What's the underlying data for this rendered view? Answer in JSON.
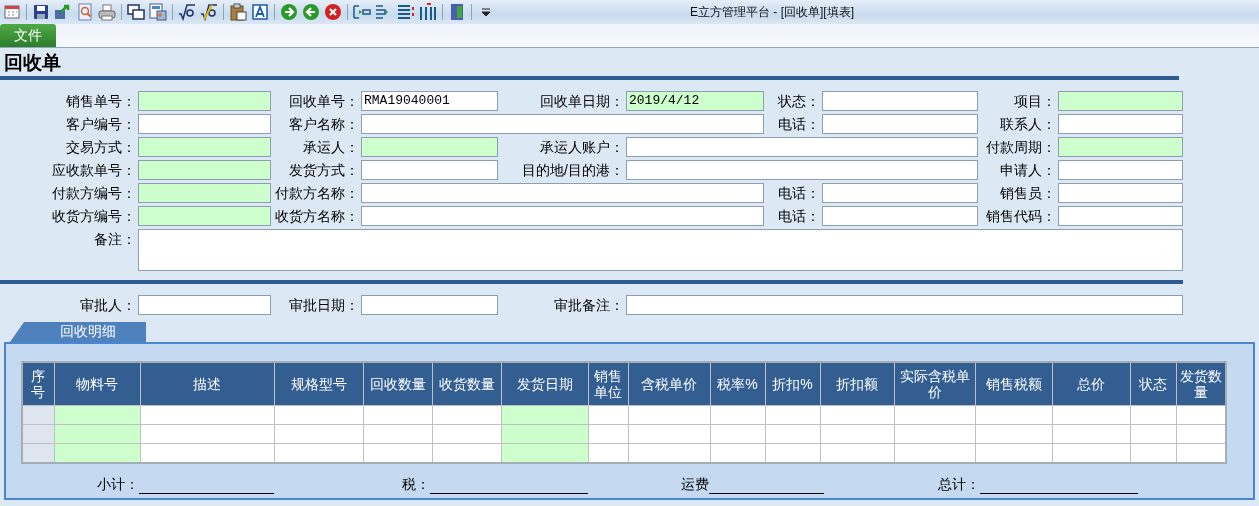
{
  "window": {
    "title": "E立方管理平台  -  [回收单][填表]"
  },
  "menu_tabs": [
    {
      "label": "文件",
      "selected": true
    }
  ],
  "page_title": "回收单",
  "form_rows": [
    [
      {
        "label": "销售单号：",
        "required": true,
        "kind": "field"
      },
      {
        "label": "回收单号：",
        "value": "RMA19040001",
        "required": false,
        "kind": "field"
      },
      {
        "label": "回收单日期：",
        "value": "2019/4/12",
        "required": true,
        "kind": "field"
      },
      {
        "label": "状态：",
        "required": false,
        "kind": "field"
      },
      {
        "label": "项目：",
        "required": true,
        "kind": "field"
      }
    ],
    [
      {
        "label": "客户编号：",
        "required": false,
        "kind": "field"
      },
      {
        "label": "客户名称：",
        "required": false,
        "kind": "wide"
      },
      {
        "label": "电话：",
        "required": false,
        "kind": "field"
      },
      {
        "label": "联系人：",
        "required": false,
        "kind": "field"
      }
    ],
    [
      {
        "label": "交易方式：",
        "required": true,
        "kind": "field"
      },
      {
        "label": "承运人：",
        "required": true,
        "kind": "field"
      },
      {
        "label": "承运人账户：",
        "required": false,
        "kind": "wide"
      },
      {
        "label": "付款周期：",
        "required": true,
        "kind": "field"
      }
    ],
    [
      {
        "label": "应收款单号：",
        "required": true,
        "kind": "field"
      },
      {
        "label": "发货方式：",
        "required": false,
        "kind": "field"
      },
      {
        "label": "目的地/目的港：",
        "required": false,
        "kind": "wide"
      },
      {
        "label": "申请人：",
        "required": false,
        "kind": "field"
      }
    ],
    [
      {
        "label": "付款方编号：",
        "required": true,
        "kind": "field"
      },
      {
        "label": "付款方名称：",
        "required": false,
        "kind": "wide"
      },
      {
        "label": "电话：",
        "required": false,
        "kind": "field"
      },
      {
        "label": "销售员：",
        "required": false,
        "kind": "field"
      }
    ],
    [
      {
        "label": "收货方编号：",
        "required": true,
        "kind": "field"
      },
      {
        "label": "收货方名称：",
        "required": false,
        "kind": "wide"
      },
      {
        "label": "电话：",
        "required": false,
        "kind": "field"
      },
      {
        "label": "销售代码：",
        "required": false,
        "kind": "field"
      }
    ],
    [
      {
        "label": "备注：",
        "required": false,
        "kind": "memo"
      }
    ]
  ],
  "approval_fields": [
    {
      "label": "审批人：",
      "required": false,
      "kind": "field"
    },
    {
      "label": "审批日期：",
      "required": false,
      "kind": "field"
    },
    {
      "label": "审批备注：",
      "required": false,
      "kind": "full"
    }
  ],
  "detail_tab": {
    "label": "回收明细",
    "selected": true
  },
  "table": {
    "columns": [
      {
        "label": "序号",
        "kind": "index",
        "required": false
      },
      {
        "label": "物料号",
        "kind": "data",
        "required": true
      },
      {
        "label": "描述",
        "kind": "data",
        "required": false
      },
      {
        "label": "规格型号",
        "kind": "data",
        "required": false
      },
      {
        "label": "回收数量",
        "kind": "data",
        "required": false
      },
      {
        "label": "收货数量",
        "kind": "data",
        "required": false
      },
      {
        "label": "发货日期",
        "kind": "data",
        "required": true
      },
      {
        "label": "销售单位",
        "kind": "data",
        "required": false
      },
      {
        "label": "含税单价",
        "kind": "data",
        "required": false
      },
      {
        "label": "税率%",
        "kind": "data",
        "required": false
      },
      {
        "label": "折扣%",
        "kind": "data",
        "required": false
      },
      {
        "label": "折扣额",
        "kind": "data",
        "required": false
      },
      {
        "label": "实际含税单价",
        "kind": "data",
        "required": false
      },
      {
        "label": "销售税额",
        "kind": "data",
        "required": false
      },
      {
        "label": "总价",
        "kind": "data",
        "required": false
      },
      {
        "label": "状态",
        "kind": "data",
        "required": false
      },
      {
        "label": "发货数量",
        "kind": "data",
        "required": false
      }
    ]
  },
  "totals": [
    {
      "label": "小计："
    },
    {
      "label": "税："
    },
    {
      "label": "运费"
    },
    {
      "label": "总计："
    }
  ]
}
